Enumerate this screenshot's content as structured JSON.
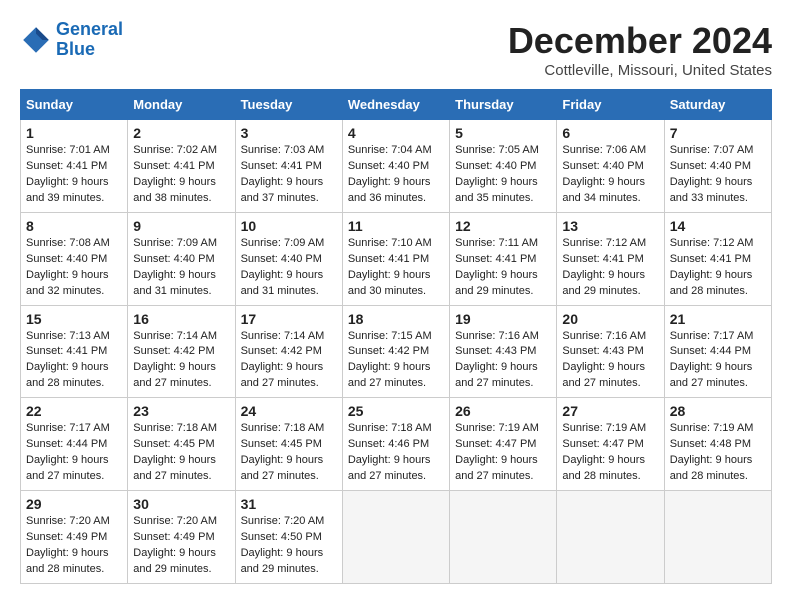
{
  "header": {
    "logo_line1": "General",
    "logo_line2": "Blue",
    "month": "December 2024",
    "location": "Cottleville, Missouri, United States"
  },
  "weekdays": [
    "Sunday",
    "Monday",
    "Tuesday",
    "Wednesday",
    "Thursday",
    "Friday",
    "Saturday"
  ],
  "weeks": [
    [
      {
        "day": "1",
        "sunrise": "7:01 AM",
        "sunset": "4:41 PM",
        "daylight": "9 hours and 39 minutes."
      },
      {
        "day": "2",
        "sunrise": "7:02 AM",
        "sunset": "4:41 PM",
        "daylight": "9 hours and 38 minutes."
      },
      {
        "day": "3",
        "sunrise": "7:03 AM",
        "sunset": "4:41 PM",
        "daylight": "9 hours and 37 minutes."
      },
      {
        "day": "4",
        "sunrise": "7:04 AM",
        "sunset": "4:40 PM",
        "daylight": "9 hours and 36 minutes."
      },
      {
        "day": "5",
        "sunrise": "7:05 AM",
        "sunset": "4:40 PM",
        "daylight": "9 hours and 35 minutes."
      },
      {
        "day": "6",
        "sunrise": "7:06 AM",
        "sunset": "4:40 PM",
        "daylight": "9 hours and 34 minutes."
      },
      {
        "day": "7",
        "sunrise": "7:07 AM",
        "sunset": "4:40 PM",
        "daylight": "9 hours and 33 minutes."
      }
    ],
    [
      {
        "day": "8",
        "sunrise": "7:08 AM",
        "sunset": "4:40 PM",
        "daylight": "9 hours and 32 minutes."
      },
      {
        "day": "9",
        "sunrise": "7:09 AM",
        "sunset": "4:40 PM",
        "daylight": "9 hours and 31 minutes."
      },
      {
        "day": "10",
        "sunrise": "7:09 AM",
        "sunset": "4:40 PM",
        "daylight": "9 hours and 31 minutes."
      },
      {
        "day": "11",
        "sunrise": "7:10 AM",
        "sunset": "4:41 PM",
        "daylight": "9 hours and 30 minutes."
      },
      {
        "day": "12",
        "sunrise": "7:11 AM",
        "sunset": "4:41 PM",
        "daylight": "9 hours and 29 minutes."
      },
      {
        "day": "13",
        "sunrise": "7:12 AM",
        "sunset": "4:41 PM",
        "daylight": "9 hours and 29 minutes."
      },
      {
        "day": "14",
        "sunrise": "7:12 AM",
        "sunset": "4:41 PM",
        "daylight": "9 hours and 28 minutes."
      }
    ],
    [
      {
        "day": "15",
        "sunrise": "7:13 AM",
        "sunset": "4:41 PM",
        "daylight": "9 hours and 28 minutes."
      },
      {
        "day": "16",
        "sunrise": "7:14 AM",
        "sunset": "4:42 PM",
        "daylight": "9 hours and 27 minutes."
      },
      {
        "day": "17",
        "sunrise": "7:14 AM",
        "sunset": "4:42 PM",
        "daylight": "9 hours and 27 minutes."
      },
      {
        "day": "18",
        "sunrise": "7:15 AM",
        "sunset": "4:42 PM",
        "daylight": "9 hours and 27 minutes."
      },
      {
        "day": "19",
        "sunrise": "7:16 AM",
        "sunset": "4:43 PM",
        "daylight": "9 hours and 27 minutes."
      },
      {
        "day": "20",
        "sunrise": "7:16 AM",
        "sunset": "4:43 PM",
        "daylight": "9 hours and 27 minutes."
      },
      {
        "day": "21",
        "sunrise": "7:17 AM",
        "sunset": "4:44 PM",
        "daylight": "9 hours and 27 minutes."
      }
    ],
    [
      {
        "day": "22",
        "sunrise": "7:17 AM",
        "sunset": "4:44 PM",
        "daylight": "9 hours and 27 minutes."
      },
      {
        "day": "23",
        "sunrise": "7:18 AM",
        "sunset": "4:45 PM",
        "daylight": "9 hours and 27 minutes."
      },
      {
        "day": "24",
        "sunrise": "7:18 AM",
        "sunset": "4:45 PM",
        "daylight": "9 hours and 27 minutes."
      },
      {
        "day": "25",
        "sunrise": "7:18 AM",
        "sunset": "4:46 PM",
        "daylight": "9 hours and 27 minutes."
      },
      {
        "day": "26",
        "sunrise": "7:19 AM",
        "sunset": "4:47 PM",
        "daylight": "9 hours and 27 minutes."
      },
      {
        "day": "27",
        "sunrise": "7:19 AM",
        "sunset": "4:47 PM",
        "daylight": "9 hours and 28 minutes."
      },
      {
        "day": "28",
        "sunrise": "7:19 AM",
        "sunset": "4:48 PM",
        "daylight": "9 hours and 28 minutes."
      }
    ],
    [
      {
        "day": "29",
        "sunrise": "7:20 AM",
        "sunset": "4:49 PM",
        "daylight": "9 hours and 28 minutes."
      },
      {
        "day": "30",
        "sunrise": "7:20 AM",
        "sunset": "4:49 PM",
        "daylight": "9 hours and 29 minutes."
      },
      {
        "day": "31",
        "sunrise": "7:20 AM",
        "sunset": "4:50 PM",
        "daylight": "9 hours and 29 minutes."
      },
      null,
      null,
      null,
      null
    ]
  ]
}
